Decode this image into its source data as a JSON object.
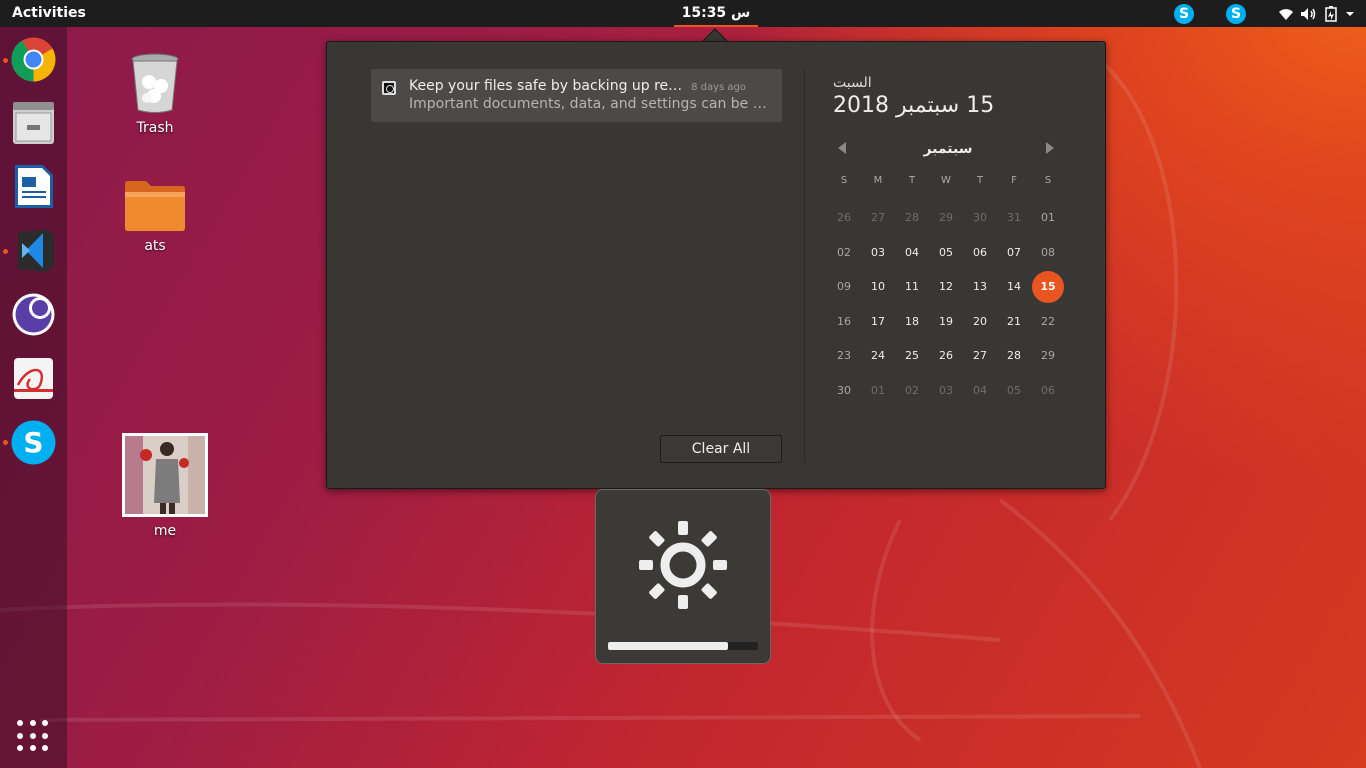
{
  "topbar": {
    "activities": "Activities",
    "clock": "س 15:35",
    "tray_icons": [
      "skype-icon",
      "skype-icon",
      "wifi-icon",
      "volume-icon",
      "battery-icon",
      "dropdown-arrow-icon"
    ]
  },
  "dock": {
    "apps": [
      {
        "name": "chrome",
        "running": true
      },
      {
        "name": "files",
        "running": false
      },
      {
        "name": "libreoffice-writer",
        "running": false
      },
      {
        "name": "vscode",
        "running": true
      },
      {
        "name": "vpn-app",
        "running": false
      },
      {
        "name": "pdf-viewer",
        "running": false
      },
      {
        "name": "skype",
        "running": true
      }
    ],
    "show_apps_icon": "apps-grid-icon"
  },
  "desktop": {
    "icons": [
      {
        "label": "Trash",
        "icon": "trash-icon"
      },
      {
        "label": "ats",
        "icon": "folder-icon"
      },
      {
        "label": "me",
        "icon": "image-thumbnail"
      }
    ]
  },
  "notifications": {
    "items": [
      {
        "title": "Keep your files safe by backing up regu…",
        "time": "8 days ago",
        "body": "Important documents, data, and settings can be pro…",
        "icon": "backup-icon"
      }
    ],
    "clear_all": "Clear All"
  },
  "calendar": {
    "weekday": "السبت",
    "full_date": "15 سبتمبر 2018",
    "month": "سبتمبر",
    "day_headers": [
      "S",
      "M",
      "T",
      "W",
      "T",
      "F",
      "S"
    ],
    "weeks": [
      [
        "26",
        "27",
        "28",
        "29",
        "30",
        "31",
        "01"
      ],
      [
        "02",
        "03",
        "04",
        "05",
        "06",
        "07",
        "08"
      ],
      [
        "09",
        "10",
        "11",
        "12",
        "13",
        "14",
        "15"
      ],
      [
        "16",
        "17",
        "18",
        "19",
        "20",
        "21",
        "22"
      ],
      [
        "23",
        "24",
        "25",
        "26",
        "27",
        "28",
        "29"
      ],
      [
        "30",
        "01",
        "02",
        "03",
        "04",
        "05",
        "06"
      ]
    ],
    "today": "15"
  },
  "osd": {
    "icon": "brightness-icon",
    "level": 0.8
  },
  "colors": {
    "accent": "#e95420",
    "panel": "#383733"
  }
}
